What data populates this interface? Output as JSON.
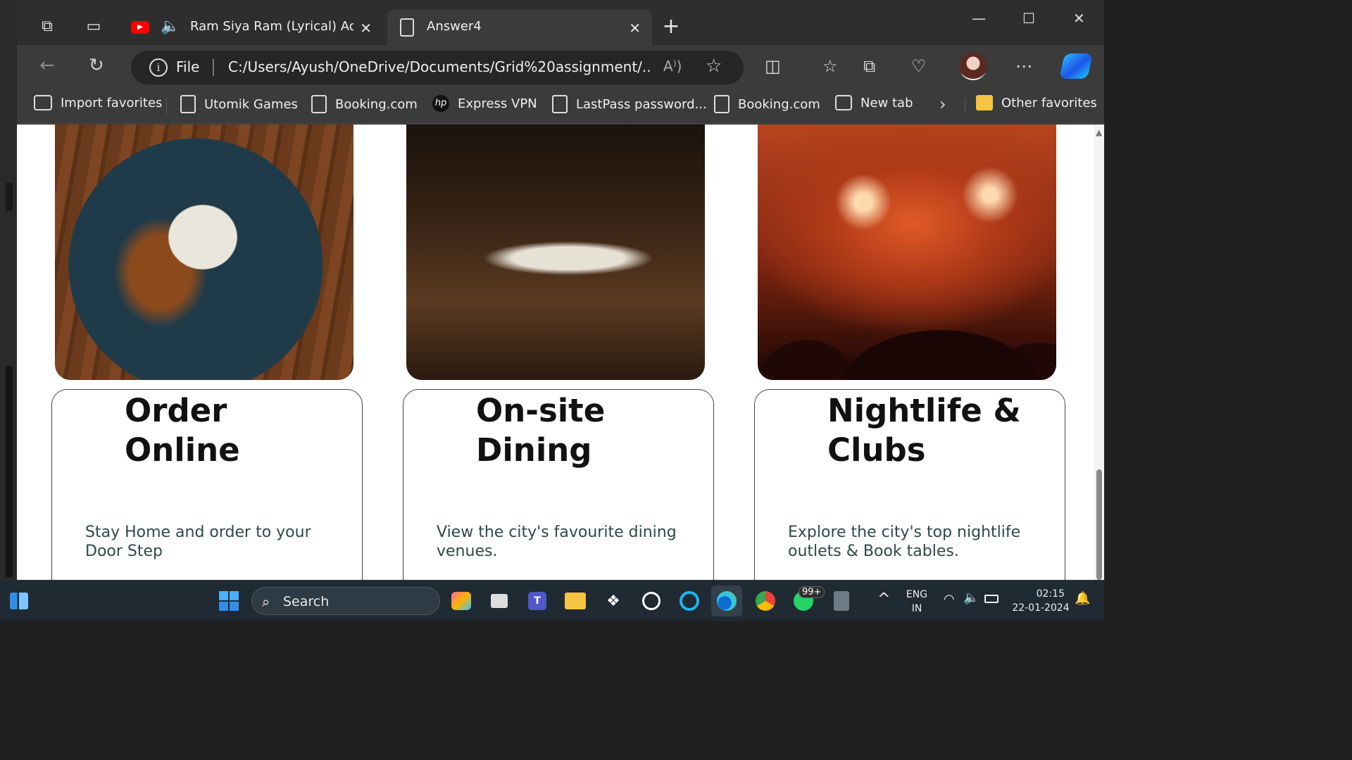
{
  "tabs": [
    {
      "title": "Ram Siya Ram (Lyrical) Adip",
      "close": "✕"
    },
    {
      "title": "Answer4",
      "close": "✕"
    }
  ],
  "window": {
    "minimize": "—",
    "maximize": "☐",
    "close": "✕"
  },
  "address": {
    "info": "i",
    "scheme": "File",
    "url": "C:/Users/Ayush/OneDrive/Documents/Grid%20assignment/...",
    "read_aloud": "A⁾)"
  },
  "favorites": [
    {
      "label": "Import favorites",
      "icon": "import-icon"
    },
    {
      "label": "Utomik Games",
      "icon": "page-icon"
    },
    {
      "label": "Booking.com",
      "icon": "page-icon"
    },
    {
      "label": "Express VPN",
      "icon": "hp-icon"
    },
    {
      "label": "LastPass password...",
      "icon": "page-icon"
    },
    {
      "label": "Booking.com",
      "icon": "page-icon"
    },
    {
      "label": "New tab",
      "icon": "newtab-icon"
    },
    {
      "label": "Other favorites",
      "icon": "folder-icon"
    }
  ],
  "cards": [
    {
      "title": "Order Online",
      "title_l1": "Order",
      "title_l2": "Online",
      "desc": "Stay Home and order to your Door Step",
      "image": "plate of chickpea curry with rice"
    },
    {
      "title": "On-site Dining",
      "title_l1": "On-site",
      "title_l2": "Dining",
      "desc": "View the city's favourite dining venues.",
      "image": "restaurant dining tables"
    },
    {
      "title": "Nightlife & Clubs",
      "title_l1": "Nightlife &",
      "title_l2": "Clubs",
      "desc": "Explore the city's top nightlife outlets & Book tables.",
      "image": "crowd at a concert"
    }
  ],
  "taskbar": {
    "search_placeholder": "Search",
    "whatsapp_badge": "99+",
    "language_top": "ENG",
    "language_bottom": "IN",
    "time": "02:15",
    "date": "22-01-2024"
  }
}
